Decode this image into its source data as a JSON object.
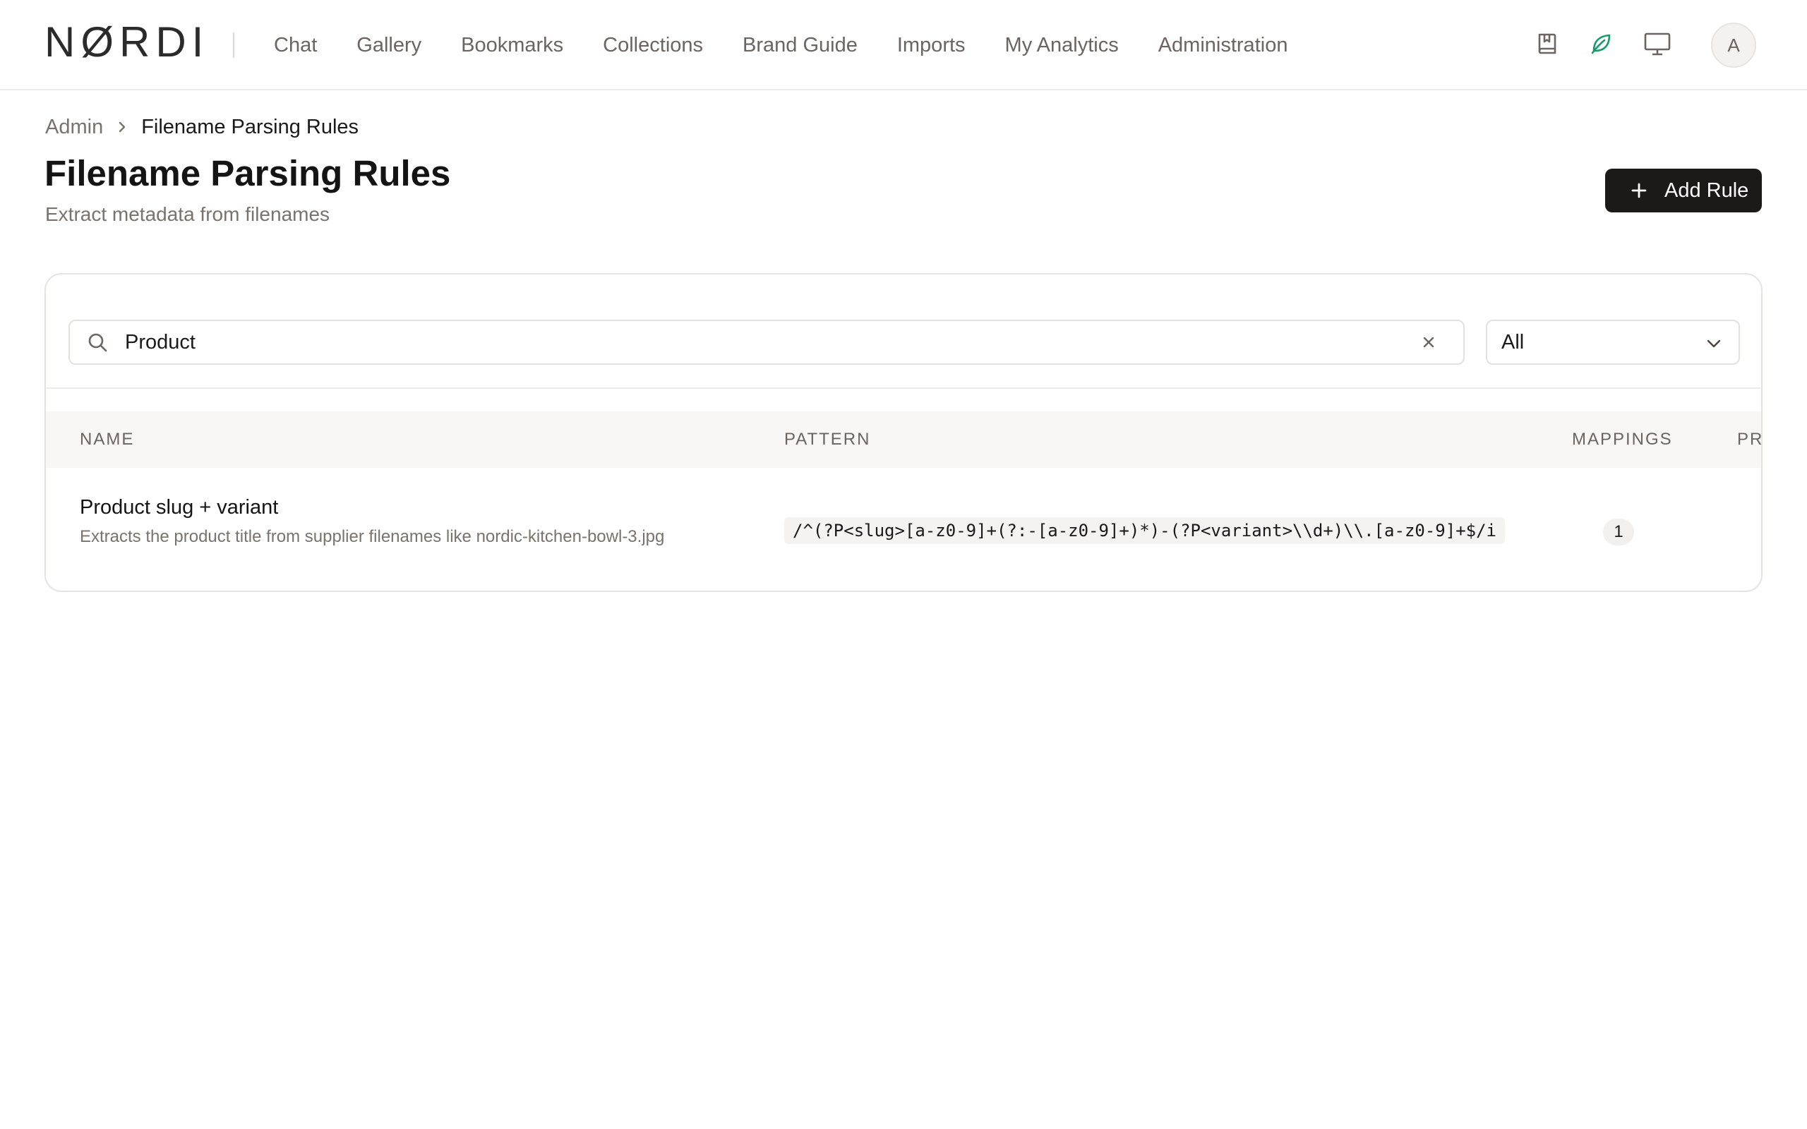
{
  "brand": {
    "logo_text": "NØRDI"
  },
  "nav": {
    "items": [
      {
        "label": "Chat"
      },
      {
        "label": "Gallery"
      },
      {
        "label": "Bookmarks"
      },
      {
        "label": "Collections"
      },
      {
        "label": "Brand Guide"
      },
      {
        "label": "Imports"
      },
      {
        "label": "My Analytics"
      },
      {
        "label": "Administration"
      }
    ],
    "icons": [
      "book-bookmark-icon",
      "leaf-icon",
      "monitor-icon"
    ],
    "accent_color": "#1a9a6b",
    "avatar_initial": "A"
  },
  "breadcrumb": {
    "parent": "Admin",
    "current": "Filename Parsing Rules"
  },
  "header": {
    "title": "Filename Parsing Rules",
    "subtitle": "Extract metadata from filenames",
    "add_button_label": "Add Rule"
  },
  "filters": {
    "search_value": "Product",
    "select_value": "All"
  },
  "table": {
    "columns": [
      "NAME",
      "PATTERN",
      "MAPPINGS",
      "PRI"
    ],
    "rows": [
      {
        "name": "Product slug + variant",
        "description": "Extracts the product title from supplier filenames like nordic-kitchen-bowl-3.jpg",
        "pattern": "/^(?P<slug>[a-z0-9]+(?:-[a-z0-9]+)*)-(?P<variant>\\\\d+)\\\\.[a-z0-9]+$/i",
        "mappings": "1"
      }
    ]
  }
}
